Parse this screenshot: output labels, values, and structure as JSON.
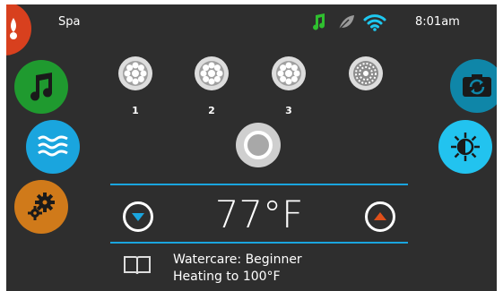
{
  "statusbar": {
    "title": "Spa",
    "time": "8:01am",
    "icons": [
      "music-note-icon",
      "leaf-icon",
      "wifi-icon"
    ],
    "music_color": "#2fbf2f",
    "wifi_color": "#1ec8f0"
  },
  "left_menu": {
    "items": [
      {
        "name": "spa-icon",
        "color": "#d8401e"
      },
      {
        "name": "music-icon",
        "color": "#1f9a2f"
      },
      {
        "name": "waves-icon",
        "color": "#1aa5de"
      },
      {
        "name": "settings-gears-icon",
        "color": "#d07a1a"
      }
    ]
  },
  "right_menu": {
    "items": [
      {
        "name": "camera-rotate-icon",
        "color": "#0f86a8"
      },
      {
        "name": "brightness-icon",
        "color": "#22c3ef"
      }
    ]
  },
  "jets": [
    {
      "label": "1"
    },
    {
      "label": "2"
    },
    {
      "label": "3"
    },
    {
      "label": ""
    }
  ],
  "temperature": {
    "value": "77°F"
  },
  "status": {
    "line1": "Watercare: Beginner",
    "line2": "Heating to 100°F"
  },
  "colors": {
    "accent": "#1aa5de",
    "down_arrow": "#1aa5de",
    "up_arrow": "#e0501a",
    "background": "#2e2e2e"
  }
}
